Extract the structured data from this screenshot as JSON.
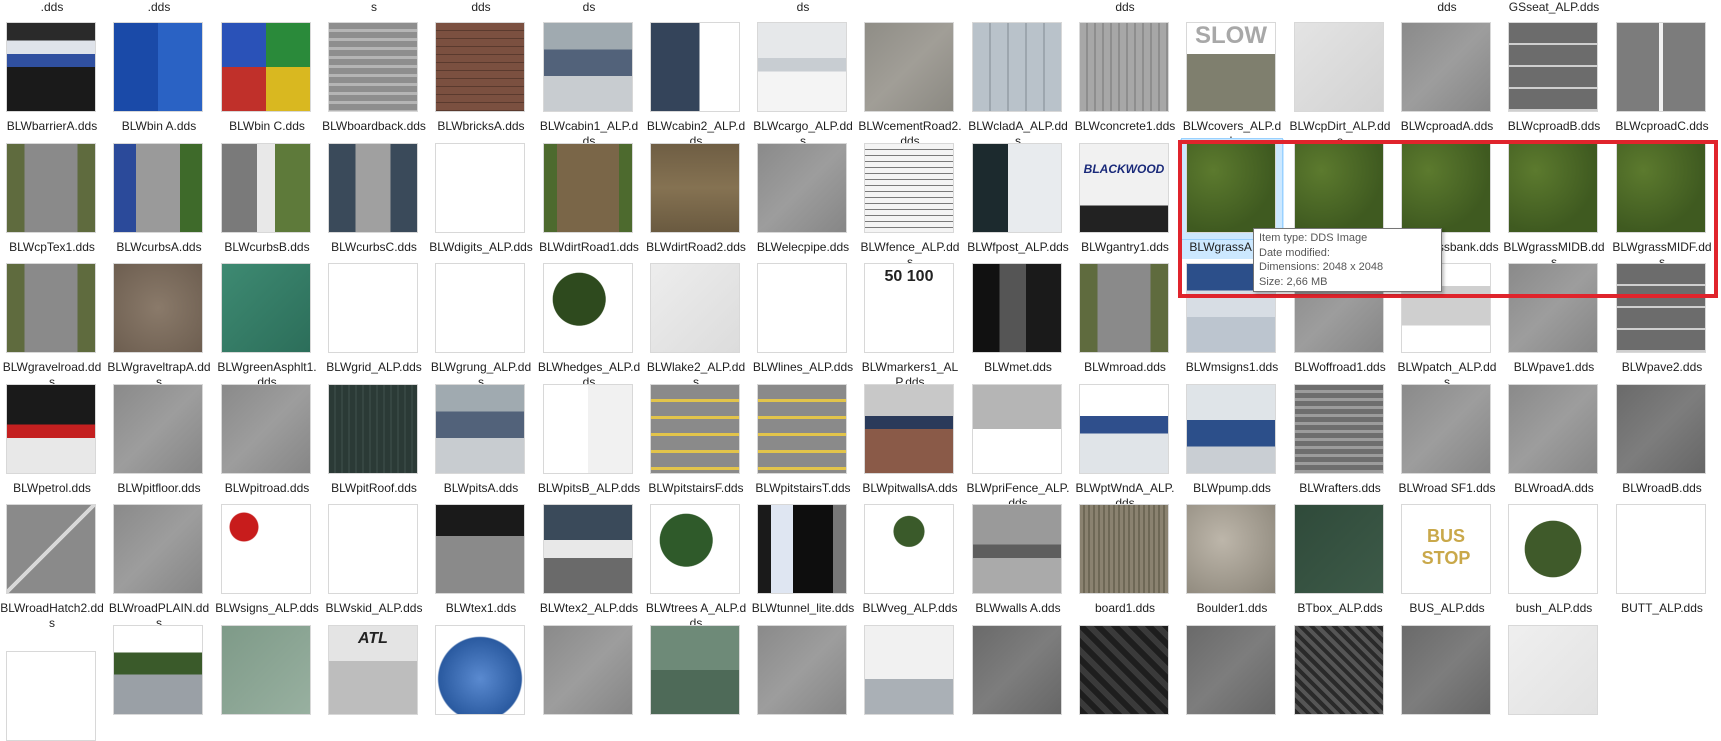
{
  "window": {
    "title": ""
  },
  "colors": {
    "highlight": "#e0242c",
    "selection": "#cce8ff",
    "tooltip_border": "#767676"
  },
  "top_row_labels": [
    ".dds",
    ".dds",
    "",
    "s",
    "dds",
    "ds",
    "",
    "ds",
    "",
    "",
    "dds",
    "",
    "",
    "dds",
    "GSseat_ALP.dds",
    ""
  ],
  "files": [
    {
      "name": "BLWbarrierA.dds",
      "kind": "barrier"
    },
    {
      "name": "BLWbin A.dds",
      "kind": "binA"
    },
    {
      "name": "BLWbin C.dds",
      "kind": "binC"
    },
    {
      "name": "BLWboardback.dds",
      "kind": "boards"
    },
    {
      "name": "BLWbricksA.dds",
      "kind": "bricks"
    },
    {
      "name": "BLWcabin1_ALP.dds",
      "kind": "cabin"
    },
    {
      "name": "BLWcabin2_ALP.dds",
      "kind": "cabin2"
    },
    {
      "name": "BLWcargo_ALP.dds",
      "kind": "cargo"
    },
    {
      "name": "BLWcementRoad2.dds",
      "kind": "cement"
    },
    {
      "name": "BLWcladA_ALP.dds",
      "kind": "clad"
    },
    {
      "name": "BLWconcrete1.dds",
      "kind": "concrete"
    },
    {
      "name": "BLWcovers_ALP.dds",
      "kind": "slow",
      "text": "SLOW"
    },
    {
      "name": "BLWcpDirt_ALP.dds",
      "kind": "whitegray"
    },
    {
      "name": "BLWcproadA.dds",
      "kind": "asphalt"
    },
    {
      "name": "BLWcproadB.dds",
      "kind": "parking"
    },
    {
      "name": "BLWcproadC.dds",
      "kind": "asphaltline"
    },
    {
      "name": "BLWcpTex1.dds",
      "kind": "roadgrass"
    },
    {
      "name": "BLWcurbsA.dds",
      "kind": "curbs"
    },
    {
      "name": "BLWcurbsB.dds",
      "kind": "curbsB"
    },
    {
      "name": "BLWcurbsC.dds",
      "kind": "curbsC"
    },
    {
      "name": "BLWdigits_ALP.dds",
      "kind": "blank"
    },
    {
      "name": "BLWdirtRoad1.dds",
      "kind": "dirt1"
    },
    {
      "name": "BLWdirtRoad2.dds",
      "kind": "dirt2"
    },
    {
      "name": "BLWelecpipe.dds",
      "kind": "asphalt"
    },
    {
      "name": "BLWfence_ALP.dds",
      "kind": "fence"
    },
    {
      "name": "BLWfpost_ALP.dds",
      "kind": "fpost"
    },
    {
      "name": "BLWgantry1.dds",
      "kind": "gantry",
      "text": "BLACKWOOD"
    },
    {
      "name": "BLWgrassA.dds",
      "kind": "grass",
      "selected": true
    },
    {
      "name": "BLWgrassB.dds",
      "kind": "grass"
    },
    {
      "name": "BLWgrassbank.dds",
      "kind": "grass"
    },
    {
      "name": "BLWgrassMIDB.dds",
      "kind": "grass"
    },
    {
      "name": "BLWgrassMIDF.dds",
      "kind": "grass"
    },
    {
      "name": "BLWgravelroad.dds",
      "kind": "roadgrass"
    },
    {
      "name": "BLWgraveltrapA.dds",
      "kind": "gravel"
    },
    {
      "name": "BLWgreenAsphlt1.dds",
      "kind": "greenasph"
    },
    {
      "name": "BLWgrid_ALP.dds",
      "kind": "grid"
    },
    {
      "name": "BLWgrung_ALP.dds",
      "kind": "blank"
    },
    {
      "name": "BLWhedges_ALP.dds",
      "kind": "hedges"
    },
    {
      "name": "BLWlake2_ALP.dds",
      "kind": "lake"
    },
    {
      "name": "BLWlines_ALP.dds",
      "kind": "blank"
    },
    {
      "name": "BLWmarkers1_ALP.dds",
      "kind": "markers",
      "text": "50 100"
    },
    {
      "name": "BLWmet.dds",
      "kind": "met"
    },
    {
      "name": "BLWmroad.dds",
      "kind": "roadgrass"
    },
    {
      "name": "BLWmsigns1.dds",
      "kind": "msigns"
    },
    {
      "name": "BLWoffroad1.dds",
      "kind": "asphalt"
    },
    {
      "name": "BLWpatch_ALP.dds",
      "kind": "patch"
    },
    {
      "name": "BLWpave1.dds",
      "kind": "asphalt"
    },
    {
      "name": "BLWpave2.dds",
      "kind": "parking"
    },
    {
      "name": "BLWpetrol.dds",
      "kind": "petrol"
    },
    {
      "name": "BLWpitfloor.dds",
      "kind": "asphalt"
    },
    {
      "name": "BLWpitroad.dds",
      "kind": "asphalt"
    },
    {
      "name": "BLWpitRoof.dds",
      "kind": "pitroof"
    },
    {
      "name": "BLWpitsA.dds",
      "kind": "cabin"
    },
    {
      "name": "BLWpitsB_ALP.dds",
      "kind": "pitsB"
    },
    {
      "name": "BLWpitstairsF.dds",
      "kind": "stairs"
    },
    {
      "name": "BLWpitstairsT.dds",
      "kind": "stairs"
    },
    {
      "name": "BLWpitwallsA.dds",
      "kind": "pitwalls"
    },
    {
      "name": "BLWpriFence_ALP.dds",
      "kind": "prifence"
    },
    {
      "name": "BLWptWndA_ALP.dds",
      "kind": "ptwnd"
    },
    {
      "name": "BLWpump.dds",
      "kind": "pump"
    },
    {
      "name": "BLWrafters.dds",
      "kind": "rafters"
    },
    {
      "name": "BLWroad SF1.dds",
      "kind": "asphalt"
    },
    {
      "name": "BLWroadA.dds",
      "kind": "asphalt"
    },
    {
      "name": "BLWroadB.dds",
      "kind": "asphaltdark"
    },
    {
      "name": "BLWroadHatch2.dds",
      "kind": "hatch"
    },
    {
      "name": "BLWroadPLAIN.dds",
      "kind": "asphalt"
    },
    {
      "name": "BLWsigns_ALP.dds",
      "kind": "signs"
    },
    {
      "name": "BLWskid_ALP.dds",
      "kind": "blank"
    },
    {
      "name": "BLWtex1.dds",
      "kind": "tex1"
    },
    {
      "name": "BLWtex2_ALP.dds",
      "kind": "tex2"
    },
    {
      "name": "BLWtrees A_ALP.dds",
      "kind": "trees"
    },
    {
      "name": "BLWtunnel_lite.dds",
      "kind": "tunnel"
    },
    {
      "name": "BLWveg_ALP.dds",
      "kind": "veg"
    },
    {
      "name": "BLWwalls A.dds",
      "kind": "walls"
    },
    {
      "name": "board1.dds",
      "kind": "board1"
    },
    {
      "name": "Boulder1.dds",
      "kind": "boulder"
    },
    {
      "name": "BTbox_ALP.dds",
      "kind": "btbox"
    },
    {
      "name": "BUS_ALP.dds",
      "kind": "bus",
      "text": "BUS STOP"
    },
    {
      "name": "bush_ALP.dds",
      "kind": "bush"
    },
    {
      "name": "BUTT_ALP.dds",
      "kind": "butt"
    },
    {
      "name": "",
      "kind": "blankpartial"
    },
    {
      "name": "",
      "kind": "landscape"
    },
    {
      "name": "",
      "kind": "greenhaze"
    },
    {
      "name": "",
      "kind": "atl",
      "text": "ATL"
    },
    {
      "name": "",
      "kind": "sky"
    },
    {
      "name": "",
      "kind": "asphalt"
    },
    {
      "name": "",
      "kind": "greenbld"
    },
    {
      "name": "",
      "kind": "asphalt"
    },
    {
      "name": "",
      "kind": "vehicle"
    },
    {
      "name": "",
      "kind": "asphaltdark"
    },
    {
      "name": "",
      "kind": "chevrondark"
    },
    {
      "name": "",
      "kind": "asphaltdark"
    },
    {
      "name": "",
      "kind": "darkpattern"
    },
    {
      "name": "",
      "kind": "asphaltdark"
    },
    {
      "name": "",
      "kind": "lightgray"
    }
  ],
  "tooltip": {
    "type": "Item type: DDS Image",
    "date": "Date modified:",
    "dimensions": "Dimensions: 2048 x 2048",
    "size": "Size: 2,66 MB"
  },
  "icons": {
    "file_thumbnail": "image-thumbnail-icon"
  }
}
